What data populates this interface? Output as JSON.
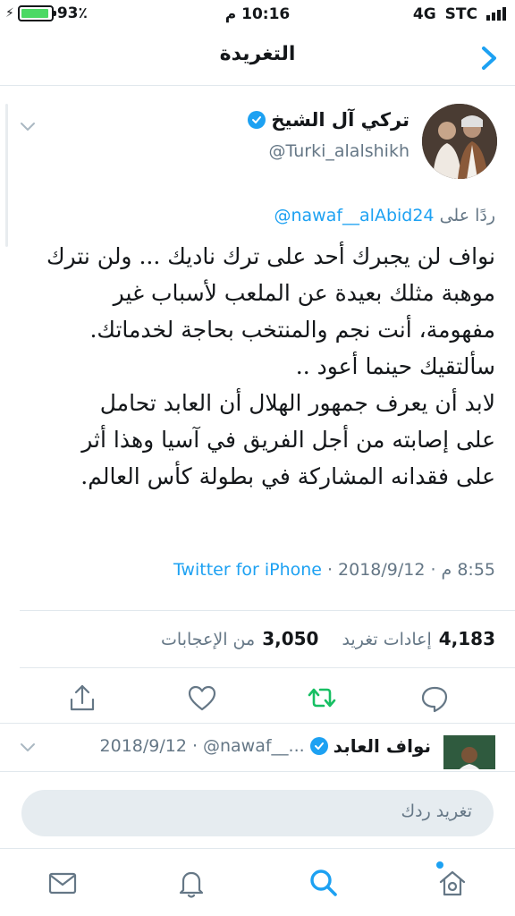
{
  "status_bar": {
    "battery_percent": "93٪",
    "battery_level": 0.93,
    "time": "10:16 م",
    "network": "4G",
    "carrier": "STC",
    "battery_color": "#4cd964"
  },
  "nav": {
    "title": "التغريدة",
    "back_icon": "chevron-right-icon"
  },
  "tweet": {
    "author_name": "تركي آل الشيخ",
    "handle": "@Turki_alalshikh",
    "reply_prefix": "ردًا على",
    "reply_to": "@nawaf__alAbid24",
    "text": "نواف لن يجبرك أحد على ترك ناديك ... ولن نترك\nموهبة مثلك بعيدة عن الملعب لأسباب غير\nمفهومة، أنت نجم والمنتخب بحاجة لخدماتك.\nسألتقيك حينما أعود ..\nلابد أن يعرف جمهور الهلال أن العابد تحامل\nعلى إصابته من أجل الفريق في آسيا وهذا أثر\nعلى فقدانه المشاركة في بطولة كأس العالم.",
    "time": "8:55 م",
    "date": "2018/9/12",
    "separator": "·",
    "source": "Twitter for iPhone",
    "retweets_count": "4,183",
    "retweets_label": "إعادات تغريد",
    "likes_count": "3,050",
    "likes_label": "من الإعجابات",
    "actions": [
      "reply-icon",
      "retweet-icon",
      "like-icon",
      "share-icon"
    ]
  },
  "next_tweet": {
    "author_name": "نواف العابد",
    "handle": "@nawaf__...",
    "separator": "·",
    "date": "2018/9/12"
  },
  "composer": {
    "placeholder": "تغريد ردك"
  },
  "tabs": [
    "home-icon",
    "search-icon",
    "notifications-icon",
    "messages-icon"
  ],
  "colors": {
    "accent": "#1da1f2",
    "retweet_active": "#17bf63",
    "muted": "#657786",
    "text": "#14171a"
  }
}
